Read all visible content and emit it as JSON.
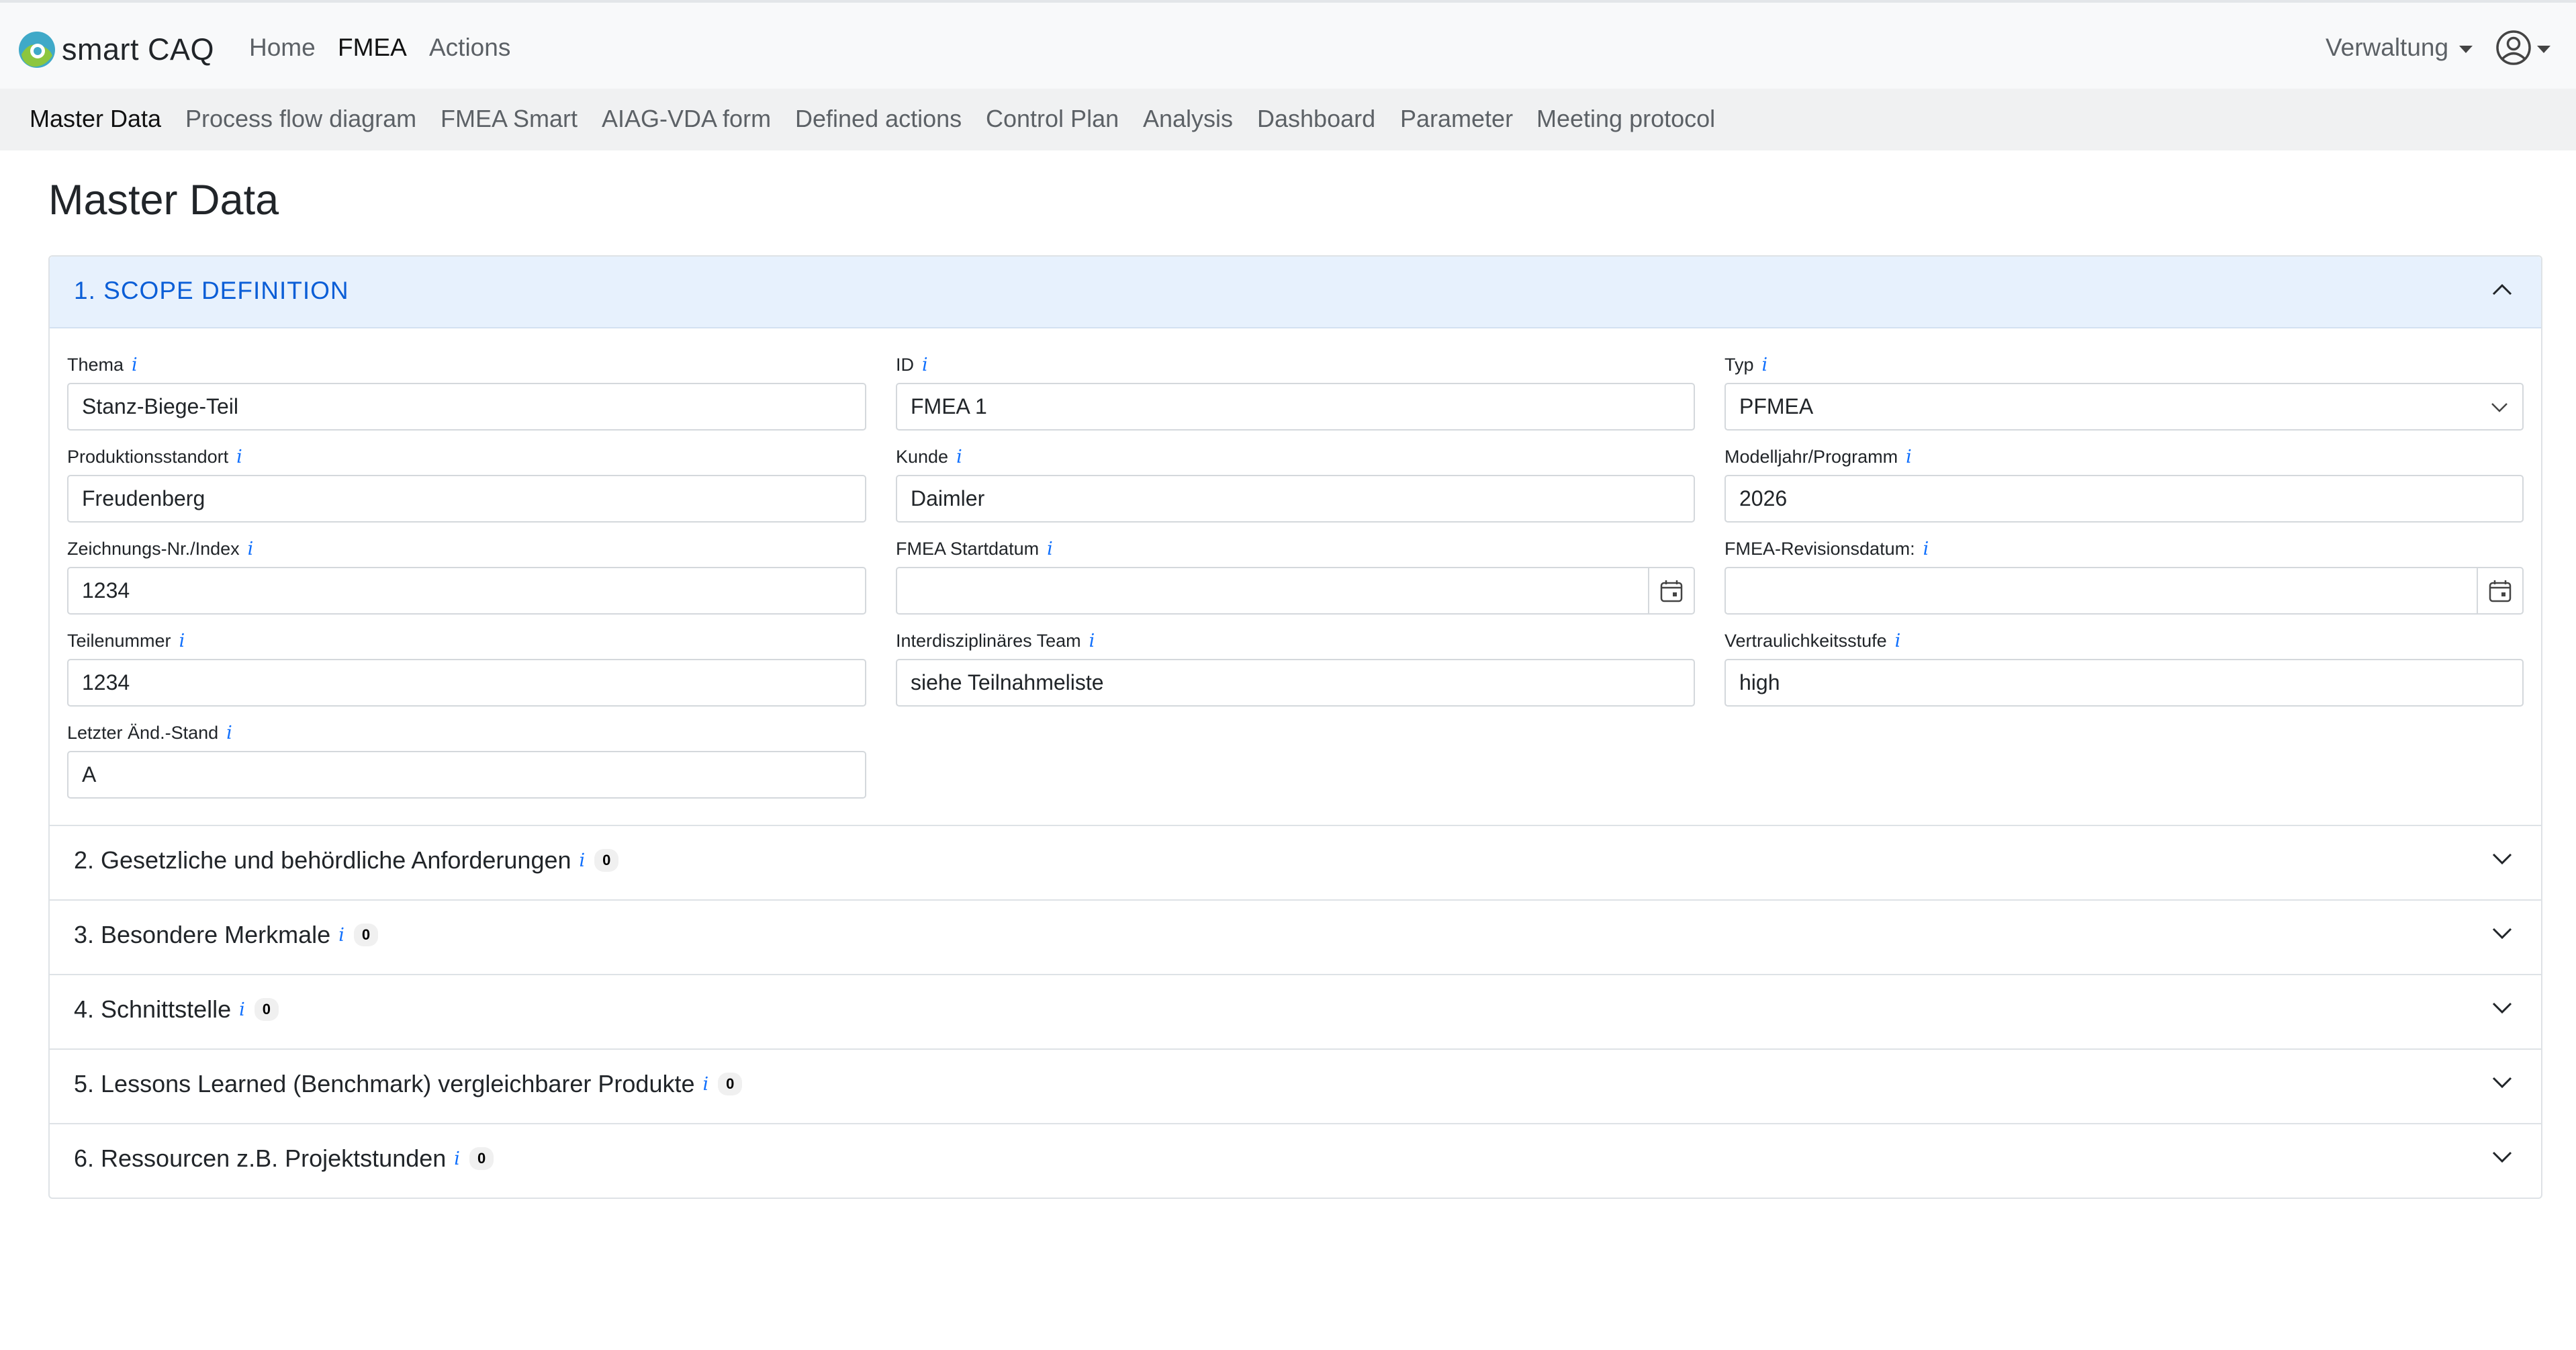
{
  "app": {
    "brand": "smart CAQ"
  },
  "topnav": {
    "home": "Home",
    "fmea": "FMEA",
    "actions": "Actions",
    "admin": "Verwaltung",
    "user_icon": "user-circle-icon"
  },
  "subnav": {
    "items": [
      "Master Data",
      "Process flow diagram",
      "FMEA Smart",
      "AIAG-VDA form",
      "Defined actions",
      "Control Plan",
      "Analysis",
      "Dashboard",
      "Parameter",
      "Meeting protocol"
    ],
    "active": "Master Data"
  },
  "page": {
    "title": "Master Data"
  },
  "scope": {
    "title": "1. SCOPE DEFINITION",
    "fields": {
      "thema": {
        "label": "Thema",
        "value": "Stanz-Biege-Teil"
      },
      "id": {
        "label": "ID",
        "value": "FMEA 1"
      },
      "typ": {
        "label": "Typ",
        "value": "PFMEA"
      },
      "standort": {
        "label": "Produktionsstandort",
        "value": "Freudenberg"
      },
      "kunde": {
        "label": "Kunde",
        "value": "Daimler"
      },
      "modelljahr": {
        "label": "Modelljahr/Programm",
        "value": "2026"
      },
      "zeichnung": {
        "label": "Zeichnungs-Nr./Index",
        "value": "1234"
      },
      "startdatum": {
        "label": "FMEA Startdatum",
        "value": ""
      },
      "revisionsdatum": {
        "label": "FMEA-Revisionsdatum:",
        "value": ""
      },
      "teilenummer": {
        "label": "Teilenummer",
        "value": "1234"
      },
      "team": {
        "label": "Interdisziplinäres Team",
        "value": "siehe Teilnahmeliste"
      },
      "vertraulichkeit": {
        "label": "Vertraulichkeitsstufe",
        "value": "high"
      },
      "aenderung": {
        "label": "Letzter Änd.-Stand",
        "value": "A"
      }
    }
  },
  "sections": [
    {
      "title": "2. Gesetzliche und behördliche Anforderungen",
      "count": "0"
    },
    {
      "title": "3. Besondere Merkmale",
      "count": "0"
    },
    {
      "title": "4. Schnittstelle",
      "count": "0"
    },
    {
      "title": "5. Lessons Learned (Benchmark) vergleichbarer Produkte",
      "count": "0"
    },
    {
      "title": "6. Ressourcen z.B. Projektstunden",
      "count": "0"
    }
  ],
  "info_marker": "i",
  "colors": {
    "accent": "#0b5ed7",
    "header_bg": "#e7f1fd",
    "navbar_bg": "#f8f9fa",
    "subnav_bg": "#f0f1f2"
  }
}
